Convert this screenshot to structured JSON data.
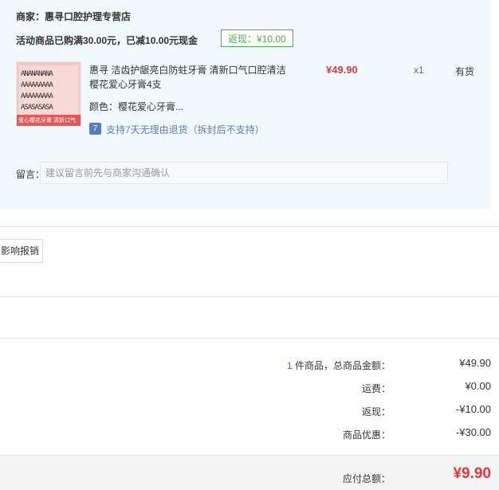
{
  "shop": {
    "seller": "商家：惠寻口腔护理专营店"
  },
  "promotion": {
    "text": "活动商品已购满30.00元，已减10.00元现金",
    "rebate_badge": "返现：¥10.00"
  },
  "item": {
    "title": "惠寻 洁齿护龈亮白防蛀牙膏 清新口气口腔清洁 樱花爱心牙膏4支",
    "price": "¥49.90",
    "quantity": "x1",
    "stock": "有货",
    "variant": "颜色：樱花爱心牙膏...",
    "return_policy": "支持7天无理由退货（拆封后不支持）",
    "return_icon": "7",
    "image_rows": [
      "ANANANANA",
      "AAAAAAAAA",
      "AAAAAAAAA",
      "ASASASASA"
    ],
    "image_tag": "爱心樱花牙膏 清新口气"
  },
  "note": {
    "label": "留言：",
    "placeholder": "建议留言前先与商家沟通确认"
  },
  "invoice": {
    "label": "影响报销"
  },
  "summary": {
    "count": "1",
    "count_suffix": " 件商品，总商品金额：",
    "subtotal": "¥49.90",
    "shipping_label": "运费：",
    "shipping": "¥0.00",
    "rebate_label": "返现：",
    "rebate": "-¥10.00",
    "discount_label": "商品优惠：",
    "discount": "-¥30.00"
  },
  "total": {
    "label": "应付总额：",
    "value": "¥9.90"
  },
  "colors": {
    "accent_red": "#e4393c",
    "rebate_green": "#4caf50",
    "panel_bg": "#f1f9fd",
    "link_blue": "#5b7bc0"
  }
}
